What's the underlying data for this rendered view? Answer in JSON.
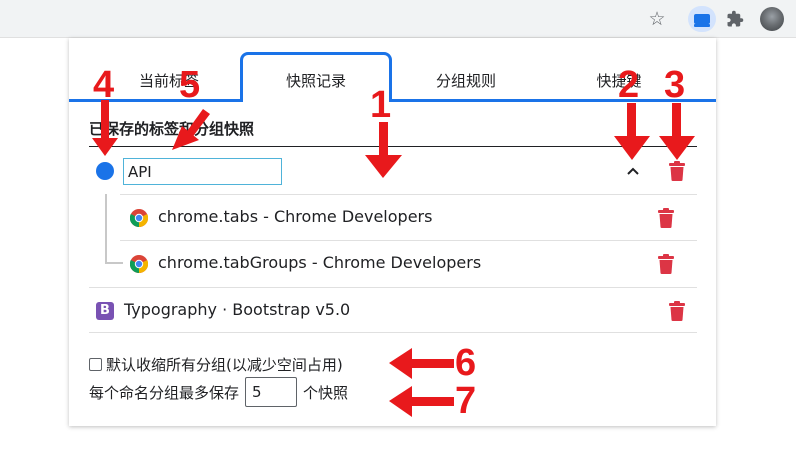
{
  "popup": {
    "tabs": [
      {
        "label": "当前标签"
      },
      {
        "label": "快照记录"
      },
      {
        "label": "分组规则"
      },
      {
        "label": "快捷键"
      }
    ],
    "section_title": "已保存的标签和分组快照",
    "group": {
      "name": "API",
      "color": "#1a73e8",
      "tabs": [
        {
          "title": "chrome.tabs - Chrome Developers",
          "icon": "chrome-icon"
        },
        {
          "title": "chrome.tabGroups - Chrome Developers",
          "icon": "chrome-icon"
        }
      ]
    },
    "single_tab": {
      "title": "Typography · Bootstrap v5.0",
      "icon_letter": "B",
      "icon_color": "#7952b3"
    },
    "options": {
      "collapse_label": "默认收缩所有分组(以减少空间占用)",
      "collapse_checked": false,
      "keep_prefix": "每个命名分组最多保存",
      "keep_value": "5",
      "keep_suffix": "个快照"
    }
  },
  "annotations": {
    "color": "#e8191c",
    "labels": [
      "1",
      "2",
      "3",
      "4",
      "5",
      "6",
      "7"
    ]
  }
}
